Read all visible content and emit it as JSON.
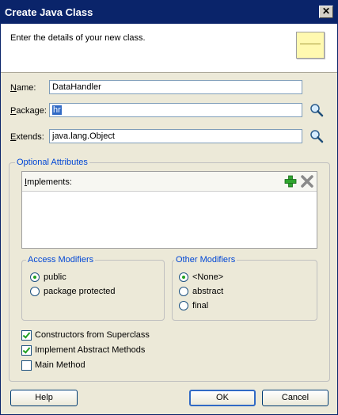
{
  "window": {
    "title": "Create Java Class"
  },
  "banner": {
    "message": "Enter the details of your new class."
  },
  "form": {
    "name": {
      "label_u": "N",
      "label_rest": "ame:",
      "value": "DataHandler"
    },
    "package": {
      "label_u": "P",
      "label_rest": "ackage:",
      "value": "hr"
    },
    "extends": {
      "label_u": "E",
      "label_rest": "xtends:",
      "value": "java.lang.Object"
    }
  },
  "optional": {
    "title": "Optional Attributes",
    "implements_label_u": "I",
    "implements_label_rest": "mplements:"
  },
  "access": {
    "title": "Access Modifiers",
    "options": [
      {
        "label_u": "",
        "label_rest": "public",
        "checked": true
      },
      {
        "label_u": "",
        "label_rest": "package protected",
        "checked": false
      }
    ],
    "public_label": "public",
    "package_label": "package protected"
  },
  "other": {
    "title": "Other Modifiers",
    "none_label": "<None>",
    "abstract_label": "abstract",
    "final_label": "final"
  },
  "options": {
    "constructors": "Constructors from Superclass",
    "abstract_methods": "Implement Abstract Methods",
    "main_method": "Main Method"
  },
  "buttons": {
    "help": "Help",
    "ok": "OK",
    "cancel": "Cancel"
  },
  "icons": {
    "close": "close-icon",
    "note": "note-icon",
    "search": "magnifier-icon",
    "add": "add-icon",
    "remove": "remove-icon"
  }
}
